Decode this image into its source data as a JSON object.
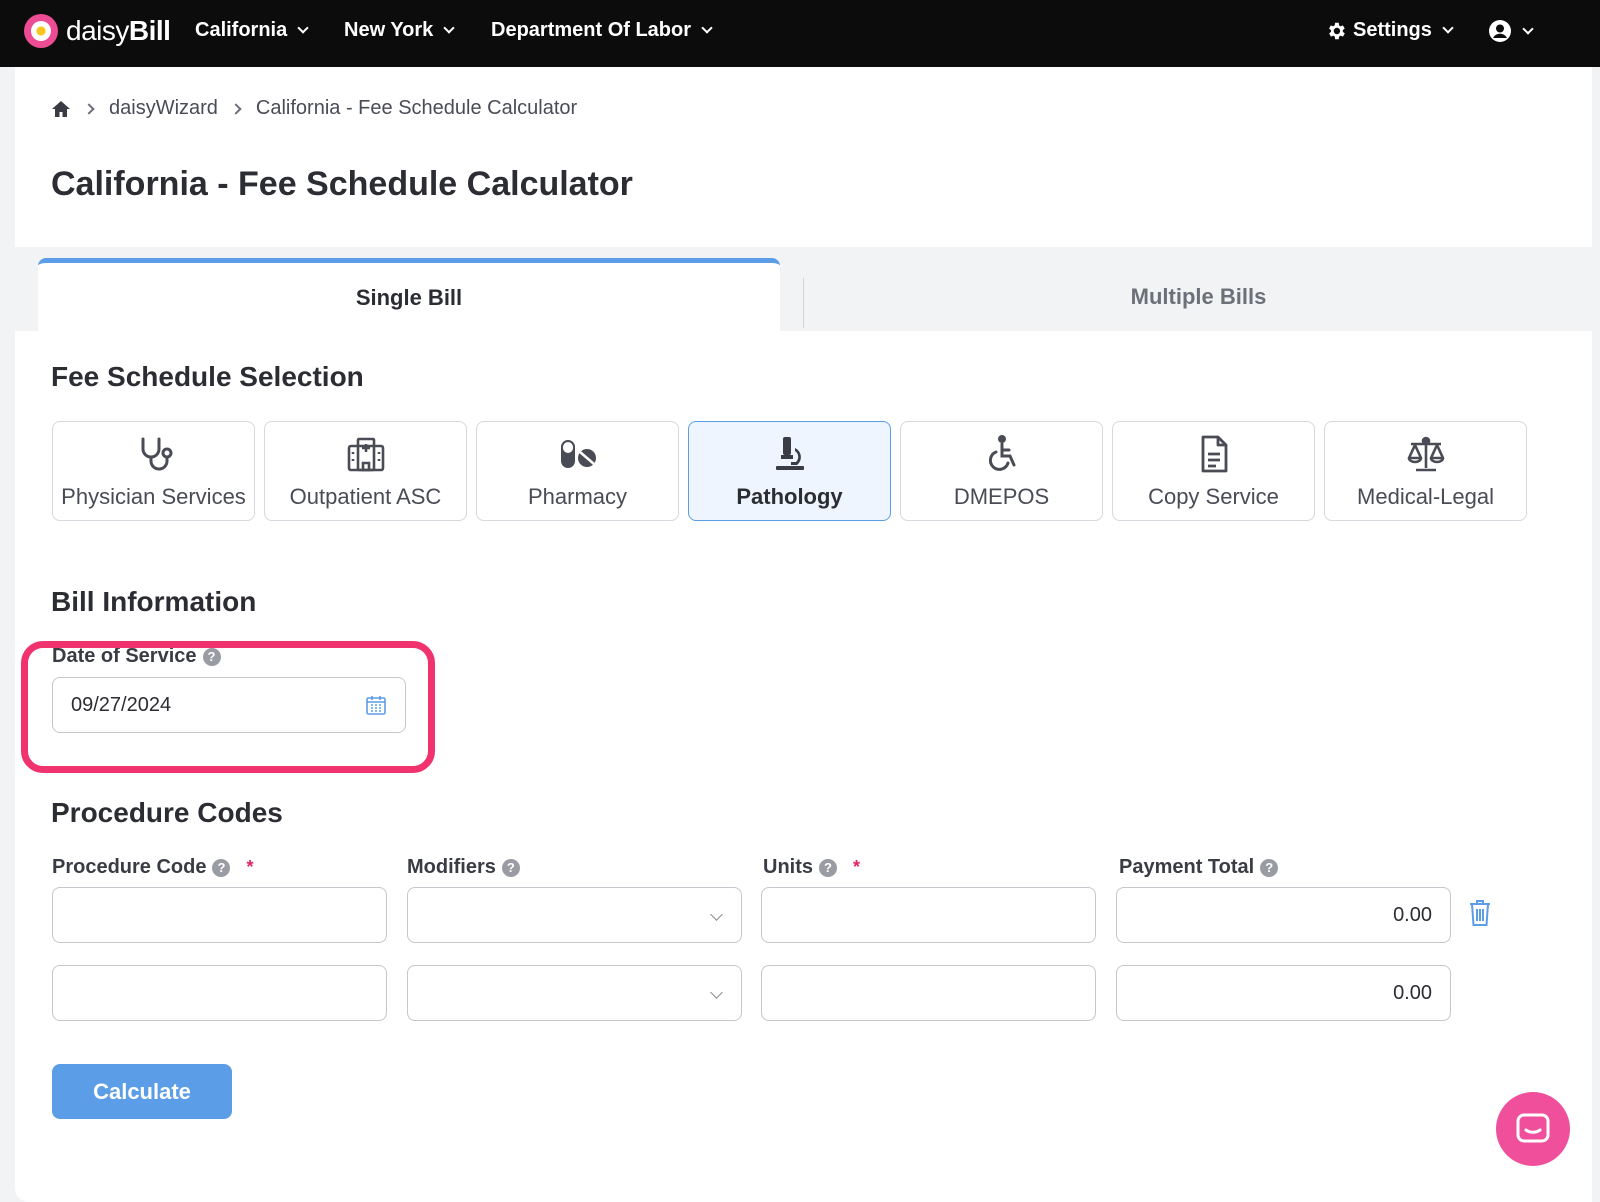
{
  "app": {
    "logo_light": "daisy",
    "logo_bold": "Bill"
  },
  "nav": {
    "items": [
      {
        "label": "California"
      },
      {
        "label": "New York"
      },
      {
        "label": "Department Of Labor"
      }
    ],
    "settings_label": "Settings"
  },
  "breadcrumb": {
    "items": [
      "daisyWizard",
      "California - Fee Schedule Calculator"
    ]
  },
  "page": {
    "title": "California - Fee Schedule Calculator"
  },
  "tabs": [
    {
      "label": "Single Bill",
      "active": true
    },
    {
      "label": "Multiple Bills",
      "active": false
    }
  ],
  "fee_schedule": {
    "title": "Fee Schedule Selection",
    "options": [
      {
        "label": "Physician Services",
        "icon": "stethoscope-icon",
        "selected": false
      },
      {
        "label": "Outpatient ASC",
        "icon": "hospital-icon",
        "selected": false
      },
      {
        "label": "Pharmacy",
        "icon": "pills-icon",
        "selected": false
      },
      {
        "label": "Pathology",
        "icon": "microscope-icon",
        "selected": true
      },
      {
        "label": "DMEPOS",
        "icon": "wheelchair-icon",
        "selected": false
      },
      {
        "label": "Copy Service",
        "icon": "document-icon",
        "selected": false
      },
      {
        "label": "Medical-Legal",
        "icon": "scales-icon",
        "selected": false
      }
    ]
  },
  "bill_info": {
    "title": "Bill Information",
    "date_label": "Date of Service",
    "date_value": "09/27/2024"
  },
  "procedures": {
    "title": "Procedure Codes",
    "columns": {
      "code": "Procedure Code",
      "modifiers": "Modifiers",
      "units": "Units",
      "total": "Payment Total"
    },
    "rows": [
      {
        "code": "",
        "modifiers": "",
        "units": "",
        "total": "0.00"
      },
      {
        "code": "",
        "modifiers": "",
        "units": "",
        "total": "0.00"
      }
    ],
    "required_mark": "*",
    "help_mark": "?"
  },
  "actions": {
    "calculate_label": "Calculate"
  },
  "colors": {
    "accent": "#5b9de6",
    "highlight": "#f0326f",
    "brand_pink": "#ec4c93",
    "topbar": "#0c0c0c"
  }
}
